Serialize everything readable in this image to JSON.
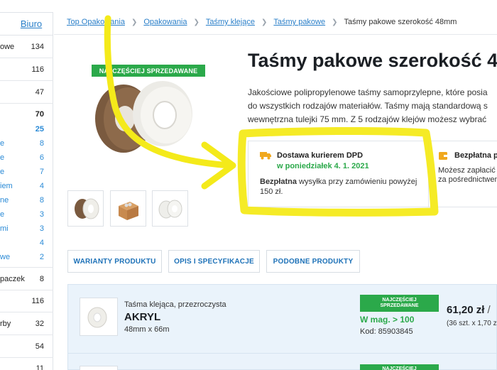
{
  "sidebar": {
    "title": "Biuro",
    "rows": [
      {
        "label": "owe",
        "count": "134"
      },
      {
        "label": "",
        "count": "116"
      },
      {
        "label": "",
        "count": "47"
      },
      {
        "label": "",
        "count": "70"
      },
      {
        "label": "",
        "count": "25"
      },
      {
        "label": "e",
        "count": "8"
      },
      {
        "label": "e",
        "count": "6"
      },
      {
        "label": "e",
        "count": "7"
      },
      {
        "label": "iem",
        "count": "4"
      },
      {
        "label": "ne",
        "count": "8"
      },
      {
        "label": "e",
        "count": "3"
      },
      {
        "label": "mi",
        "count": "3"
      },
      {
        "label": "",
        "count": "4"
      },
      {
        "label": "we",
        "count": "2"
      },
      {
        "label": "paczek",
        "count": "8"
      },
      {
        "label": "",
        "count": "116"
      },
      {
        "label": "rby",
        "count": "32"
      },
      {
        "label": "",
        "count": "54"
      },
      {
        "label": "",
        "count": "11"
      }
    ]
  },
  "breadcrumb": {
    "items": [
      "Top Opakowania",
      "Opakowania",
      "Taśmy klejące",
      "Taśmy pakowe"
    ],
    "current": "Taśmy pakowe szerokość 48mm"
  },
  "product": {
    "badge": "NAJCZĘŚCIEJ SPRZEDAWANE",
    "title": "Taśmy pakowe szerokość 4",
    "description_lines": [
      "Jakościowe polipropylenowe taśmy samoprzylepne, które posia",
      "do wszystkich rodzajów materiałów. Taśmy mają standardową s",
      "wewnętrzna tulejki 75 mm. Z 5 rodzajów klejów możesz wybrać"
    ]
  },
  "delivery": {
    "title": "Dostawa kurierem DPD",
    "date": "w poniedziałek 4. 1. 2021",
    "bold_text": "Bezpłatna",
    "text_rest": " wysyłka przy zamówieniu powyżej 150 zł."
  },
  "payment": {
    "title": "Bezpłatna p",
    "line1": "Możesz zapłacić",
    "line2": "za pośrednictwem"
  },
  "tabs": [
    "WARIANTY PRODUKTU",
    "OPIS I SPECYFIKACJE",
    "PODOBNE PRODUKTY"
  ],
  "variant": {
    "type": "Taśma klejąca, przezroczysta",
    "name": "AKRYL",
    "size": "48mm x 66m",
    "badge_line1": "NAJCZĘŚCIEJ",
    "badge_line2": "SPRZEDAWANE",
    "stock": "W mag. > 100",
    "code": "Kod: 85903845",
    "price": "61,20 zł",
    "price_suffix": " /",
    "unit": "(36 szt. x 1,70 z"
  },
  "variant2": {
    "badge_line1": "NAJCZĘŚCIEJ"
  },
  "colors": {
    "accent_blue": "#2a7fc9",
    "badge_green": "#2ba94a",
    "highlighter_yellow": "#f4ea1a"
  }
}
